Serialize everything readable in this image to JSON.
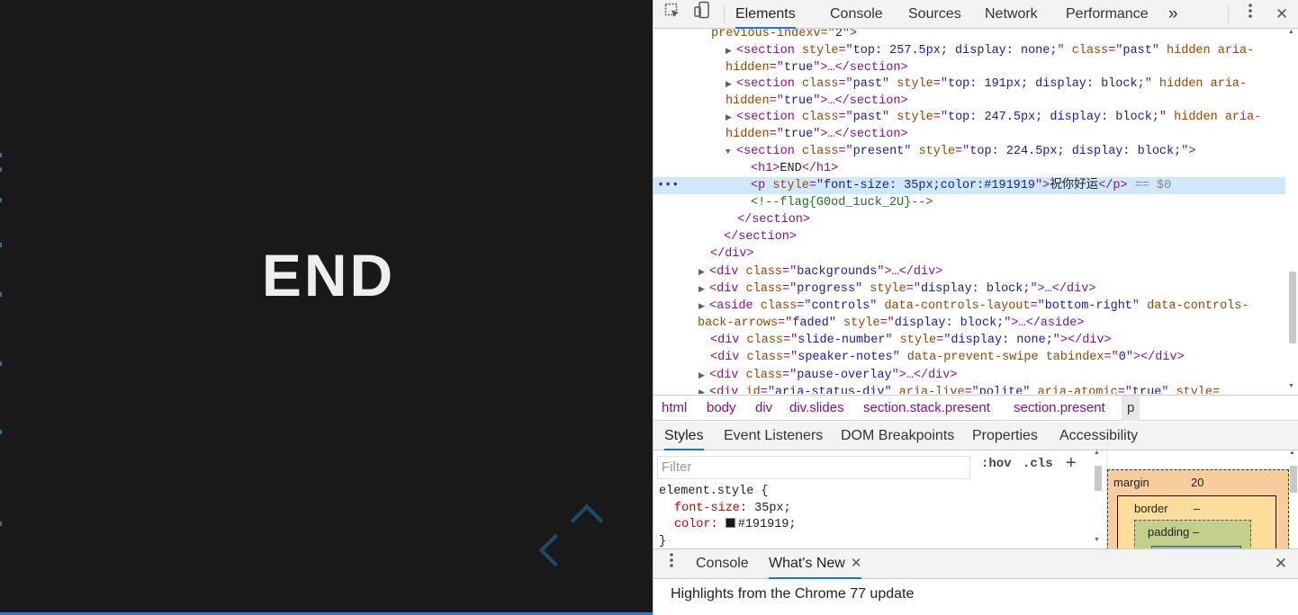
{
  "slide": {
    "title": "END",
    "text": "祝你好运",
    "progress": 1.0
  },
  "toolbar": {
    "tabs": [
      "Elements",
      "Console",
      "Sources",
      "Network",
      "Performance"
    ],
    "more": "»",
    "close": "✕"
  },
  "dom": {
    "l0": {
      "pre": "previous-indexv=\"",
      "val": "2",
      "post": "\">"
    },
    "l1": {
      "open": "<section ",
      "a1": "style",
      "v1": "top: 257.5px; display: none;",
      "a2": "class",
      "v2": "past",
      "a3": "hidden aria-"
    },
    "l1b": {
      "a": "hidden",
      "v": "true",
      "rest": ">…</section>"
    },
    "l2": {
      "open": "<section ",
      "a1": "class",
      "v1": "past",
      "a2": "style",
      "v2": "top: 191px; display: block;",
      "a3": "hidden aria-"
    },
    "l2b": {
      "a": "hidden",
      "v": "true",
      "rest": ">…</section>"
    },
    "l3": {
      "open": "<section ",
      "a1": "class",
      "v1": "past",
      "a2": "style",
      "v2": "top: 247.5px; display: block;",
      "a3": "hidden aria-"
    },
    "l3b": {
      "a": "hidden",
      "v": "true",
      "rest": ">…</section>"
    },
    "l4": {
      "open": "<section ",
      "a1": "class",
      "v1": "present",
      "a2": "style",
      "v2": "top: 224.5px; display: block;",
      "close": ">"
    },
    "l5": {
      "open": "<h1>",
      "txt": "END",
      "close": "</h1>"
    },
    "l6": {
      "open": "<p ",
      "a1": "style",
      "v1": "font-size: 35px;color:#191919",
      "txt": "祝你好运",
      "close": "</p>",
      "eq": " == $0"
    },
    "l7": {
      "cmt": "<!--flag{G0od_1uck_2U}-->"
    },
    "l8": "</section>",
    "l9": "</section>",
    "l10": "</div>",
    "l11": {
      "open": "<div ",
      "a1": "class",
      "v1": "backgrounds",
      "rest": ">…</div>"
    },
    "l12": {
      "open": "<div ",
      "a1": "class",
      "v1": "progress",
      "a2": "style",
      "v2": "display: block;",
      "rest": ">…</div>"
    },
    "l13": {
      "open": "<aside ",
      "a1": "class",
      "v1": "controls",
      "a2": "data-controls-layout",
      "v2": "bottom-right",
      "a3": "data-controls-"
    },
    "l13b": {
      "a": "back-arrows",
      "v": "faded",
      "a2": "style",
      "v2": "display: block;",
      "rest": ">…</aside>"
    },
    "l14": {
      "open": "<div ",
      "a1": "class",
      "v1": "slide-number",
      "a2": "style",
      "v2": "display: none;",
      "rest": "></div>"
    },
    "l15": {
      "open": "<div ",
      "a1": "class",
      "v1": "speaker-notes",
      "a2": "data-prevent-swipe",
      "a3": "tabindex",
      "v3": "0",
      "rest": "></div>"
    },
    "l16": {
      "open": "<div ",
      "a1": "class",
      "v1": "pause-overlay",
      "rest": ">…</div>"
    },
    "l17": {
      "open": "<div ",
      "a1": "id",
      "v1": "aria-status-div",
      "a2": "aria-live",
      "v2": "polite",
      "a3": "aria-atomic",
      "v3": "true",
      "a4": "style="
    }
  },
  "breadcrumb": [
    "html",
    "body",
    "div",
    "div.slides",
    "section.stack.present",
    "section.present",
    "p"
  ],
  "subtabs": [
    "Styles",
    "Event Listeners",
    "DOM Breakpoints",
    "Properties",
    "Accessibility"
  ],
  "styles": {
    "filter_placeholder": "Filter",
    "hov": ":hov",
    "cls": ".cls",
    "plus": "+",
    "selector": "element.style {",
    "p1_name": "font-size",
    "p1_val": "35px;",
    "p2_name": "color",
    "p2_val": "#191919;",
    "close_brace": "}",
    "swatch_color": "#191919"
  },
  "boxmodel": {
    "margin_label": "margin",
    "margin_val": "20",
    "border_label": "border",
    "border_val": "–",
    "padding_label": "padding –"
  },
  "drawer": {
    "tabs": [
      "Console",
      "What's New"
    ],
    "tab_close": "✕",
    "close": "✕",
    "highlights": "Highlights from the Chrome 77 update"
  }
}
